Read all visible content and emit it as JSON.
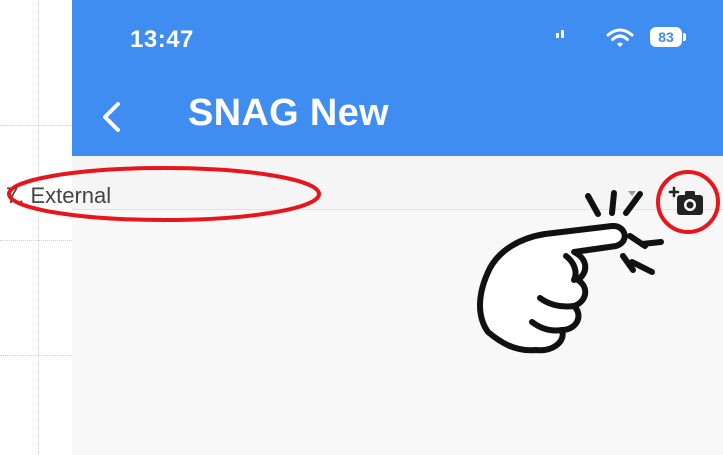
{
  "status_bar": {
    "time": "13:47",
    "battery": "83",
    "icons": [
      "signal-icon",
      "wifi-icon",
      "battery-icon"
    ]
  },
  "nav_bar": {
    "title": "SNAG New",
    "back_icon": "chevron-left-icon"
  },
  "form": {
    "row_label": "7. External",
    "dropdown_icon": "dropdown-arrow-icon",
    "camera_icon": "add-photo-camera-icon"
  },
  "annotations": {
    "highlight_color": "#e8161c",
    "pointer_icon": "pointing-hand-icon"
  },
  "colors": {
    "header_blue": "#3f8df0",
    "text": "#444444",
    "content_bg": "#f8f8f9"
  }
}
